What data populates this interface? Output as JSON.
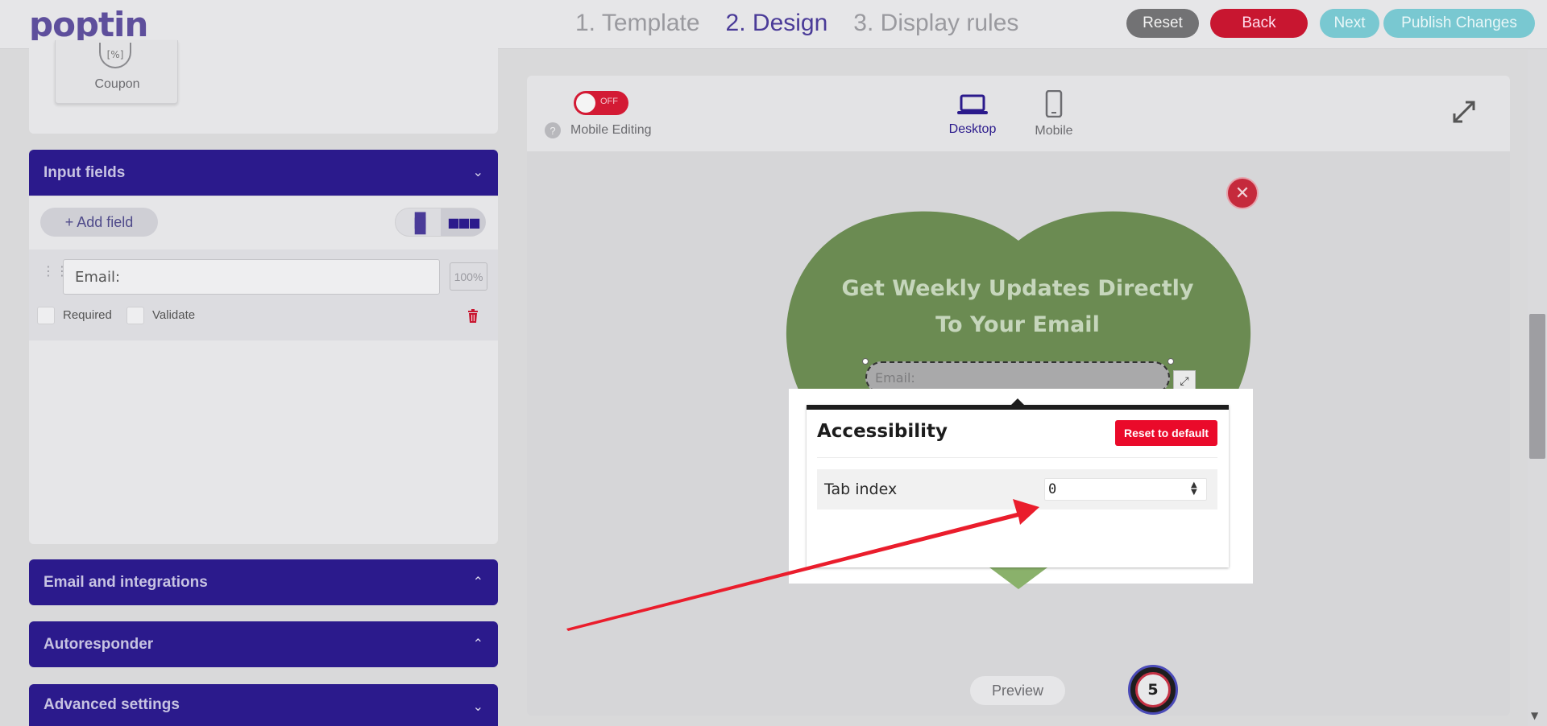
{
  "header": {
    "logo": "poptin",
    "steps": [
      "1. Template",
      "2. Design",
      "3. Display rules"
    ],
    "active_step": 1,
    "reset_label": "Reset",
    "back_label": "Back",
    "next_label": "Next",
    "publish_label": "Publish Changes"
  },
  "sidebar": {
    "coupon_label": "Coupon",
    "coupon_icon_glyph": "[%]",
    "input_fields": {
      "title": "Input fields",
      "add_field_label": "+ Add field",
      "field": {
        "value": "Email:",
        "width_label": "100%",
        "required_label": "Required",
        "validate_label": "Validate"
      }
    },
    "sections": [
      {
        "title": "Email and integrations"
      },
      {
        "title": "Autoresponder"
      },
      {
        "title": "Advanced settings"
      }
    ]
  },
  "canvas": {
    "toggle_label": "OFF",
    "help_glyph": "?",
    "mobile_editing_label": "Mobile Editing",
    "desktop_label": "Desktop",
    "mobile_label": "Mobile",
    "popup": {
      "headline_line1": "Get Weekly Updates Directly",
      "headline_line2": "To Your Email",
      "email_placeholder": "Email:",
      "close_glyph": "✕"
    },
    "accessibility": {
      "title": "Accessibility",
      "reset_label": "Reset to default",
      "tab_index_label": "Tab index",
      "tab_index_value": "0"
    },
    "preview_label": "Preview",
    "badge_count": "5"
  },
  "colors": {
    "brand_purple": "#2b1a8c",
    "danger_red": "#ea0a2a",
    "heart_green": "#6b8b52",
    "teal": "#79c8d1"
  }
}
